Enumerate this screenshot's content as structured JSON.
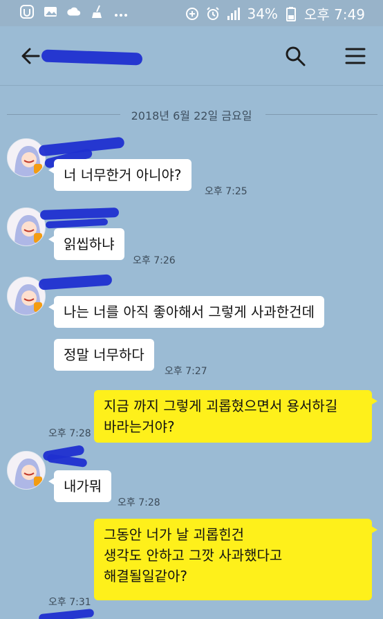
{
  "status_bar": {
    "battery": "34%",
    "time": "오후 7:49",
    "left_icons": [
      "app-icon",
      "gallery-icon",
      "cloud-icon",
      "broom-icon",
      "more-dots-icon"
    ],
    "right_icons": [
      "data-saver-icon",
      "alarm-icon",
      "signal-icon",
      "battery-icon"
    ]
  },
  "header": {
    "title": "",
    "icons": [
      "back-arrow-icon",
      "search-icon",
      "menu-icon"
    ]
  },
  "date_divider": "2018년 6월 22일 금요일",
  "messages": [
    {
      "side": "in",
      "text": "너 너무한거 아니야?",
      "time": "오후 7:25"
    },
    {
      "side": "in",
      "text": "읽씹하냐",
      "time": "오후 7:26"
    },
    {
      "side": "in",
      "text": "나는 너를 아직 좋아해서 그렇게 사과한건데",
      "time": ""
    },
    {
      "side": "in",
      "text": "정말 너무하다",
      "time": "오후 7:27"
    },
    {
      "side": "out",
      "lines": [
        "지금 까지 그렇게 괴롭혔으면서 용서하길",
        "바라는거야?"
      ],
      "time": "오후 7:28"
    },
    {
      "side": "in",
      "text": "내가뭐",
      "time": "오후 7:28"
    },
    {
      "side": "out",
      "lines": [
        "그동안 너가 날 괴롭힌건",
        "생각도 안하고 그깟 사과했다고",
        "해결될일같아?"
      ],
      "time": "오후 7:31"
    }
  ],
  "colors": {
    "background": "#9bbbd4",
    "incoming_bubble": "#ffffff",
    "outgoing_bubble": "#fef01b",
    "redaction": "#1f2fd0"
  }
}
